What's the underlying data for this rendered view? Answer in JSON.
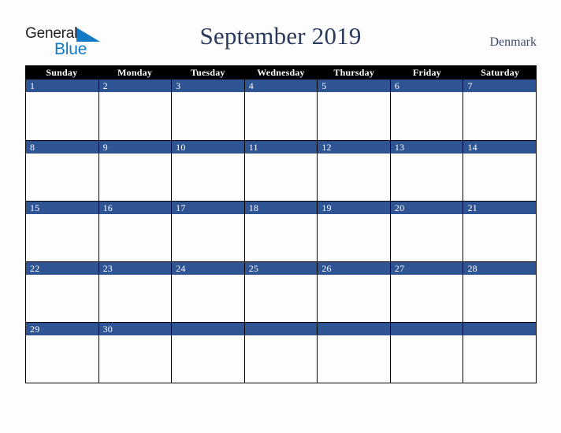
{
  "logo": {
    "text_primary": "General",
    "text_secondary": "Blue",
    "triangle_icon": "triangle-icon",
    "primary_color": "#231f20",
    "secondary_color": "#1279c6"
  },
  "header": {
    "title": "September 2019",
    "country": "Denmark",
    "title_color": "#2b3a5c"
  },
  "calendar": {
    "month": "September",
    "year": "2019",
    "accent_color": "#2e5494",
    "header_background": "#000000",
    "header_text_color": "#ffffff",
    "weekday_headers": [
      "Sunday",
      "Monday",
      "Tuesday",
      "Wednesday",
      "Thursday",
      "Friday",
      "Saturday"
    ],
    "weeks": [
      {
        "days": [
          {
            "num": "1"
          },
          {
            "num": "2"
          },
          {
            "num": "3"
          },
          {
            "num": "4"
          },
          {
            "num": "5"
          },
          {
            "num": "6"
          },
          {
            "num": "7"
          }
        ]
      },
      {
        "days": [
          {
            "num": "8"
          },
          {
            "num": "9"
          },
          {
            "num": "10"
          },
          {
            "num": "11"
          },
          {
            "num": "12"
          },
          {
            "num": "13"
          },
          {
            "num": "14"
          }
        ]
      },
      {
        "days": [
          {
            "num": "15"
          },
          {
            "num": "16"
          },
          {
            "num": "17"
          },
          {
            "num": "18"
          },
          {
            "num": "19"
          },
          {
            "num": "20"
          },
          {
            "num": "21"
          }
        ]
      },
      {
        "days": [
          {
            "num": "22"
          },
          {
            "num": "23"
          },
          {
            "num": "24"
          },
          {
            "num": "25"
          },
          {
            "num": "26"
          },
          {
            "num": "27"
          },
          {
            "num": "28"
          }
        ]
      },
      {
        "days": [
          {
            "num": "29"
          },
          {
            "num": "30"
          },
          {
            "num": ""
          },
          {
            "num": ""
          },
          {
            "num": ""
          },
          {
            "num": ""
          },
          {
            "num": ""
          }
        ]
      }
    ]
  }
}
